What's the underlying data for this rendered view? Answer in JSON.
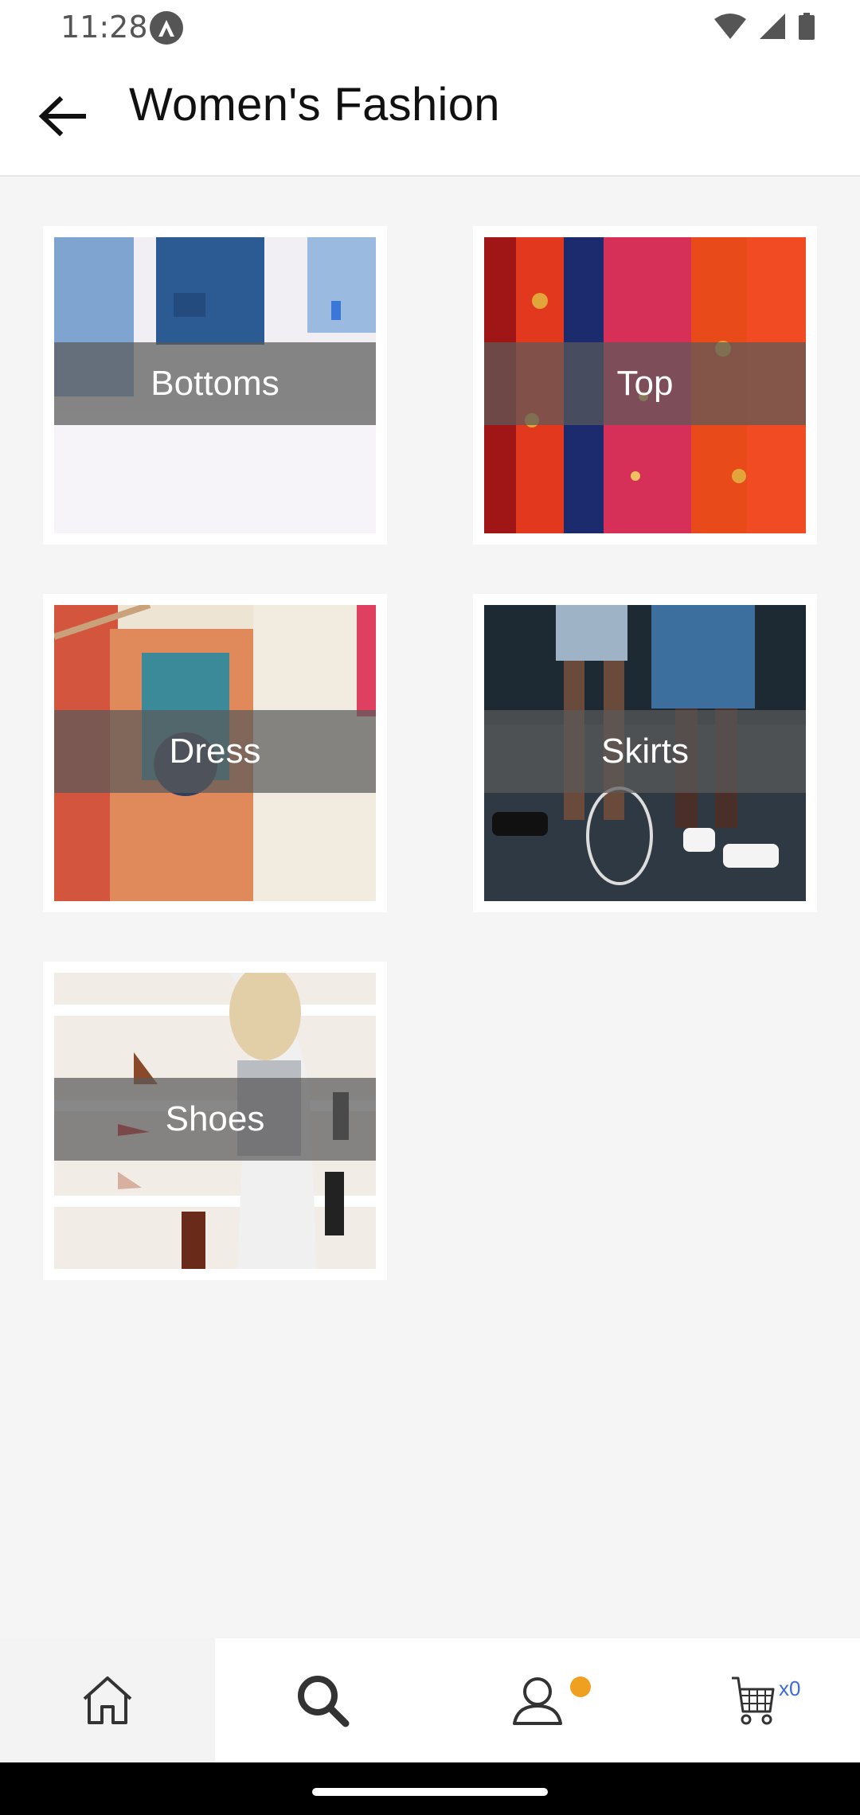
{
  "status_bar": {
    "time": "11:28",
    "icons": [
      "app-notification-icon",
      "wifi-icon",
      "cellular-signal-icon",
      "battery-icon"
    ]
  },
  "app_bar": {
    "back_icon": "arrow-left-icon",
    "title": "Women's Fashion"
  },
  "categories": [
    {
      "label": "Bottoms",
      "image": "jeans-photo"
    },
    {
      "label": "Top",
      "image": "red-blouses-photo"
    },
    {
      "label": "Dress",
      "image": "patterned-dress-rack-photo"
    },
    {
      "label": "Skirts",
      "image": "denim-skirts-tennis-photo"
    },
    {
      "label": "Shoes",
      "image": "shoe-shelf-photo"
    }
  ],
  "bottom_nav": {
    "items": [
      {
        "icon": "home-icon"
      },
      {
        "icon": "search-icon"
      },
      {
        "icon": "profile-icon"
      },
      {
        "icon": "cart-icon"
      }
    ],
    "cart_count": "x0",
    "accent_color": "#f0a020",
    "cart_count_color": "#3d6bd6"
  }
}
